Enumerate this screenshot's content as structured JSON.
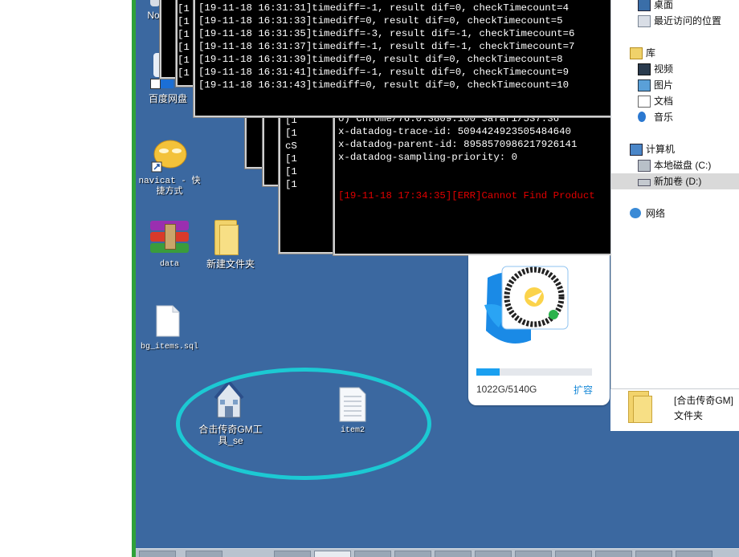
{
  "desktop_icons": [
    {
      "id": "no",
      "label": "No"
    },
    {
      "id": "baidu",
      "label": "百度网盘"
    },
    {
      "id": "navicat",
      "label": "navicat - 快捷方式"
    },
    {
      "id": "data",
      "label": "data"
    },
    {
      "id": "new-folder",
      "label": "新建文件夹"
    },
    {
      "id": "bg-items",
      "label": "bg_items.sql"
    },
    {
      "id": "gm-tool",
      "label": "合击传奇GM工具_se"
    },
    {
      "id": "item2",
      "label": "item2"
    }
  ],
  "console_front": {
    "lines": [
      "[19-11-18 16:31:31]timediff=-1, result dif=0, checkTimecount=4",
      "[19-11-18 16:31:33]timediff=0, result dif=0, checkTimecount=5",
      "[19-11-18 16:31:35]timediff=-3, result dif=-1, checkTimecount=6",
      "[19-11-18 16:31:37]timediff=-1, result dif=-1, checkTimecount=7",
      "[19-11-18 16:31:39]timediff=0, result dif=0, checkTimecount=8",
      "[19-11-18 16:31:41]timediff=-1, result dif=0, checkTimecount=9",
      "[19-11-18 16:31:43]timediff=0, result dif=0, checkTimecount=10"
    ],
    "left_fragments": [
      "[1",
      "[1",
      "[1",
      "[1",
      "[1",
      "[1",
      "[1"
    ]
  },
  "console_back": {
    "lines": [
      "o) Chrome/76.0.3809.100 Safari/537.36",
      "x-datadog-trace-id: 5094424923505484640",
      "x-datadog-parent-id: 8958570986217926141",
      "x-datadog-sampling-priority: 0"
    ],
    "error_line": "[19-11-18 17:34:35][ERR]Cannot Find Product",
    "left_fragments": [
      "[1",
      "[1",
      "cS",
      "[1",
      "[1",
      "[1"
    ]
  },
  "promo": {
    "storage": "1022G/5140G",
    "expand": "扩容",
    "used_fraction": 0.1999
  },
  "explorer": {
    "items": [
      {
        "id": "desktop",
        "label": "桌面",
        "icon": "desktop-icon"
      },
      {
        "id": "recent",
        "label": "最近访问的位置",
        "icon": "recent-places-icon"
      },
      {
        "id": "library",
        "label": "库",
        "icon": "library-icon"
      },
      {
        "id": "videos",
        "label": "视频",
        "icon": "video-icon"
      },
      {
        "id": "pictures",
        "label": "图片",
        "icon": "picture-icon"
      },
      {
        "id": "documents",
        "label": "文档",
        "icon": "document-icon"
      },
      {
        "id": "music",
        "label": "音乐",
        "icon": "music-icon"
      },
      {
        "id": "computer",
        "label": "计算机",
        "icon": "computer-icon"
      },
      {
        "id": "local-disk",
        "label": "本地磁盘 (C:)",
        "icon": "local-disk-icon"
      },
      {
        "id": "new-volume",
        "label": "新加卷 (D:)",
        "icon": "drive-icon",
        "selected": true
      },
      {
        "id": "network",
        "label": "网络",
        "icon": "network-icon"
      }
    ],
    "selected_folder": {
      "name": "[合击传奇GM]",
      "type": "文件夹"
    }
  },
  "colors": {
    "desktop": "#3b68a0",
    "ellipse": "#1cc9d3",
    "error_text": "#e10000",
    "progress": "#1aa0f0",
    "expand_link": "#1a8ad8"
  }
}
